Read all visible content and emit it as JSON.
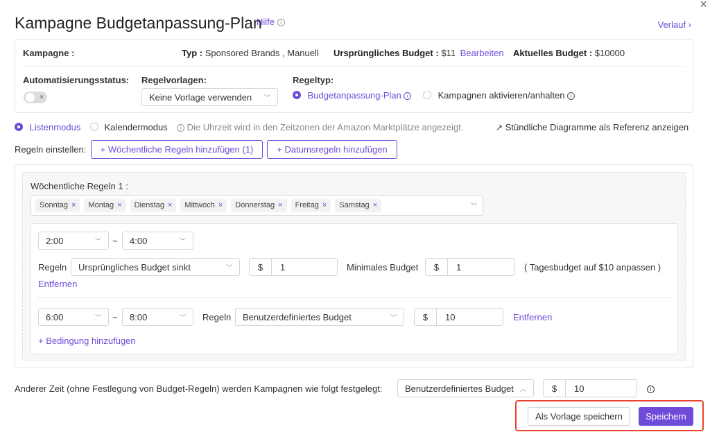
{
  "header": {
    "title": "Kampagne Budgetanpassung-Plan",
    "help": "Hilfe",
    "history": "Verlauf ›",
    "close": "×"
  },
  "info_panel": {
    "campaign_label": "Kampagne :",
    "type_label": "Typ :",
    "type_value": "Sponsored Brands , Manuell",
    "original_budget_label": "Ursprüngliches Budget :",
    "original_budget_value": "$11",
    "edit": "Bearbeiten",
    "current_budget_label": "Aktuelles Budget :",
    "current_budget_value": "$10000",
    "automation_label": "Automatisierungsstatus:",
    "toggle_off": "×",
    "templates_label": "Regelvorlagen:",
    "template_selected": "Keine Vorlage verwenden",
    "rule_type_label": "Regeltyp:",
    "rule_type_options": [
      "Budgetanpassung-Plan",
      "Kampagnen aktivieren/anhalten"
    ]
  },
  "mode": {
    "list_mode": "Listenmodus",
    "calendar_mode": "Kalendermodus",
    "timezone_note": "Die Uhrzeit wird in den Zeitzonen der Amazon Marktplätze angezeigt.",
    "hourly_chart_link": "Stündliche Diagramme als Referenz anzeigen"
  },
  "rules_bar": {
    "label": "Regeln einstellen:",
    "add_weekly": "+ Wöchentliche Regeln hinzufügen (1)",
    "add_date": "+ Datumsregeln hinzufügen"
  },
  "weekly_rules": {
    "title": "Wöchentliche Regeln 1 :",
    "days": [
      "Sonntag",
      "Montag",
      "Dienstag",
      "Mittwoch",
      "Donnerstag",
      "Freitag",
      "Samstag"
    ],
    "tag_remove": "×",
    "row1": {
      "from": "2:00",
      "tilde": "~",
      "to": "4:00",
      "rules_label": "Regeln",
      "rule_select": "Ursprüngliches Budget sinkt",
      "currency": "$",
      "amount": "1",
      "min_budget_label": "Minimales Budget",
      "min_currency": "$",
      "min_amount": "1",
      "note": "( Tagesbudget auf $10 anpassen )",
      "remove": "Entfernen"
    },
    "row2": {
      "from": "6:00",
      "tilde": "~",
      "to": "8:00",
      "rules_label": "Regeln",
      "rule_select": "Benutzerdefiniertes Budget",
      "currency": "$",
      "amount": "10",
      "remove": "Entfernen"
    },
    "add_condition": "+ Bedingung hinzufügen"
  },
  "footer": {
    "other_time_text": "Anderer Zeit (ohne Festlegung von Budget-Regeln) werden Kampagnen wie folgt festgelegt:",
    "other_select": "Benutzerdefiniertes Budget",
    "currency": "$",
    "amount": "10",
    "save_template": "Als Vorlage speichern",
    "save": "Speichern"
  },
  "colors": {
    "accent": "#6e4bd8",
    "highlight": "#e8432e"
  }
}
